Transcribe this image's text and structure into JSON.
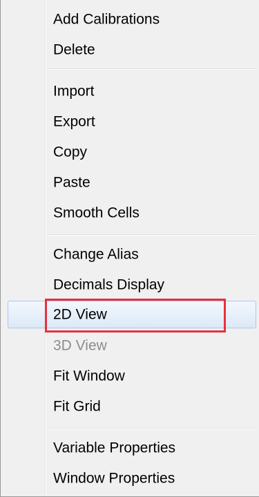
{
  "context_menu": {
    "items": [
      {
        "label": "Add Calibrations",
        "enabled": true
      },
      {
        "label": "Delete",
        "enabled": true
      },
      {
        "label": "Import",
        "enabled": true
      },
      {
        "label": "Export",
        "enabled": true
      },
      {
        "label": "Copy",
        "enabled": true
      },
      {
        "label": "Paste",
        "enabled": true
      },
      {
        "label": "Smooth Cells",
        "enabled": true
      },
      {
        "label": "Change Alias",
        "enabled": true
      },
      {
        "label": "Decimals Display",
        "enabled": true
      },
      {
        "label": "2D View",
        "enabled": true,
        "hovered": true
      },
      {
        "label": "3D View",
        "enabled": false
      },
      {
        "label": "Fit Window",
        "enabled": true
      },
      {
        "label": "Fit Grid",
        "enabled": true
      },
      {
        "label": "Variable Properties",
        "enabled": true
      },
      {
        "label": "Window Properties",
        "enabled": true
      }
    ]
  },
  "colors": {
    "menu_background": "#f0f0f0",
    "hover_border": "#a8c8ef",
    "highlight_annotation": "#e8303c",
    "disabled_text": "#8d8d8d"
  }
}
